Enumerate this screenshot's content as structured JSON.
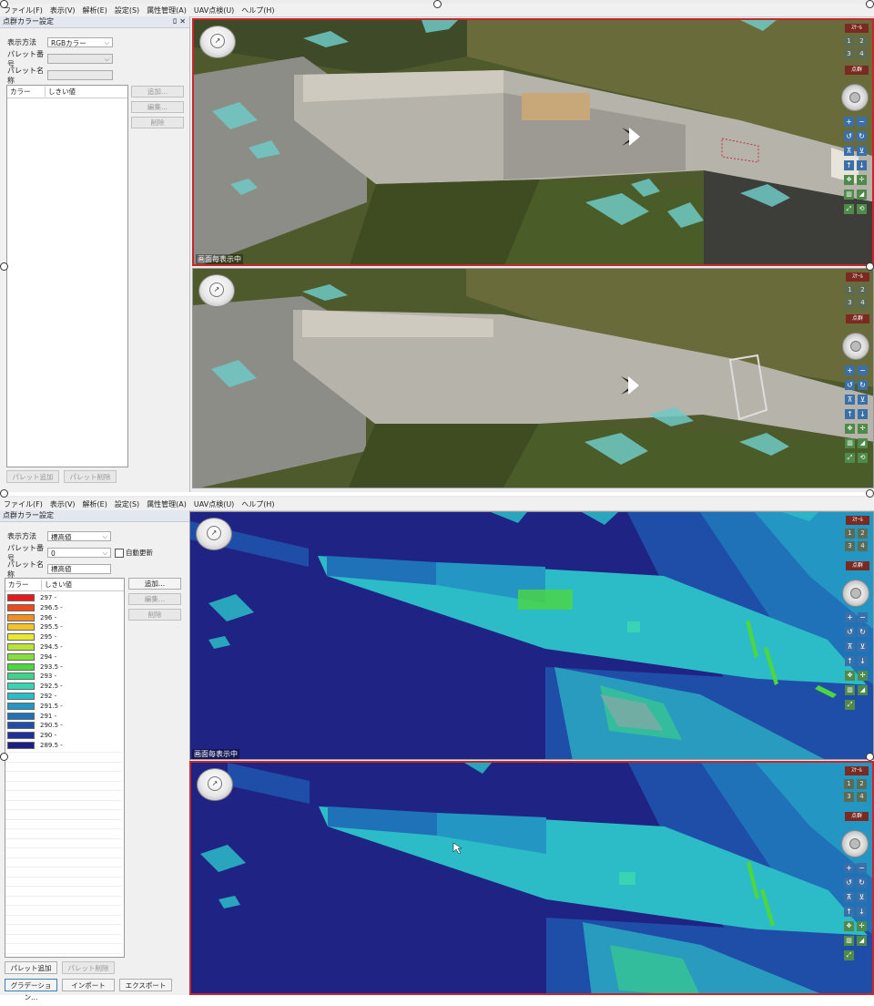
{
  "menu": [
    "ファイル(F)",
    "表示(V)",
    "解析(E)",
    "設定(S)",
    "属性管理(A)",
    "UAV点検(U)",
    "ヘルプ(H)"
  ],
  "top": {
    "panel_title": "点群カラー設定",
    "display_method_label": "表示方法",
    "display_method_value": "RGBカラー",
    "palette_number_label": "パレット番号",
    "palette_number_value": "",
    "palette_name_label": "パレット名称",
    "palette_name_value": "",
    "list_headers": [
      "カラー",
      "しきい値"
    ],
    "side_buttons": [
      "追加...",
      "編集...",
      "削除"
    ],
    "bottom_buttons": [
      "パレット追加",
      "パレット削除"
    ],
    "view_label": "画面毎表示中"
  },
  "bottom": {
    "panel_title": "点群カラー設定",
    "display_method_label": "表示方法",
    "display_method_value": "標高値",
    "palette_number_label": "パレット番号",
    "palette_number_value": "0",
    "auto_update_label": "自動更新",
    "palette_name_label": "パレット名称",
    "palette_name_value": "標高値",
    "list_headers": [
      "カラー",
      "しきい値"
    ],
    "side_buttons": [
      "追加...",
      "編集...",
      "削除"
    ],
    "palette_buttons": [
      "パレット追加",
      "パレット削除"
    ],
    "action_buttons": [
      "グラデーション...",
      "インポート",
      "エクスポート"
    ],
    "view_label": "画面毎表示中",
    "palette": [
      {
        "color": "#e8191b",
        "value": "297 -"
      },
      {
        "color": "#ea4a1d",
        "value": "296.5 -"
      },
      {
        "color": "#ef8e21",
        "value": "296 -"
      },
      {
        "color": "#f3c42a",
        "value": "295.5 -"
      },
      {
        "color": "#e8e830",
        "value": "295 -"
      },
      {
        "color": "#b8e43a",
        "value": "294.5 -"
      },
      {
        "color": "#86de3e",
        "value": "294 -"
      },
      {
        "color": "#4cd640",
        "value": "293.5 -"
      },
      {
        "color": "#3cd486",
        "value": "293 -"
      },
      {
        "color": "#38d4b4",
        "value": "292.5 -"
      },
      {
        "color": "#2cbcc8",
        "value": "292 -"
      },
      {
        "color": "#2496c4",
        "value": "291.5 -"
      },
      {
        "color": "#1f72b8",
        "value": "291 -"
      },
      {
        "color": "#1f4ea8",
        "value": "290.5 -"
      },
      {
        "color": "#1f2f98",
        "value": "290 -"
      },
      {
        "color": "#1c1f82",
        "value": "289.5 -"
      }
    ]
  },
  "toolbar": {
    "label_top": "ｽｹｰﾙ",
    "label_mid": "点群",
    "btn1": "1",
    "btn2": "2",
    "btn3": "3",
    "btn4": "4"
  },
  "icons": [
    "compass-icon",
    "zoom-wheel-icon",
    "zoom-in-icon",
    "zoom-out-icon",
    "rotate-left-icon",
    "rotate-right-icon",
    "up-arrow-icon",
    "down-arrow-icon",
    "grid-icon",
    "fit-icon"
  ]
}
